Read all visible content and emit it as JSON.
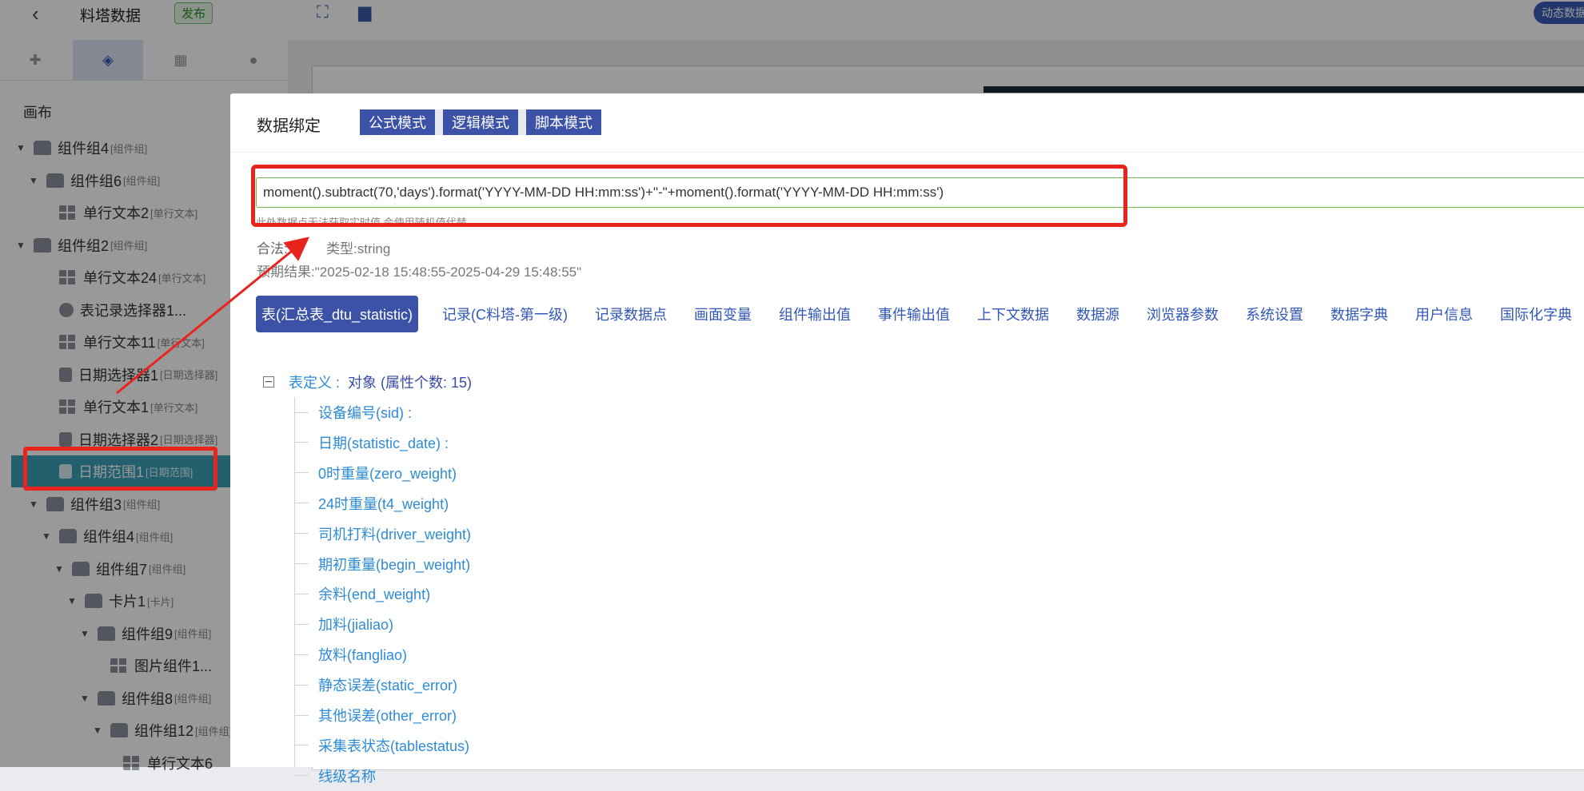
{
  "topbar": {
    "title": "料塔数据",
    "publish_label": "发布",
    "dynamic_label": "动态数据"
  },
  "left_panel": {
    "canvas_label": "画布",
    "tree": [
      {
        "level": 0,
        "arrow": "down",
        "icon": "group",
        "label": "组件组4",
        "tag": "[组件组]"
      },
      {
        "level": 1,
        "arrow": "down",
        "icon": "group",
        "label": "组件组6",
        "tag": "[组件组]"
      },
      {
        "level": 2,
        "arrow": "",
        "icon": "text",
        "label": "单行文本2",
        "tag": "[单行文本]"
      },
      {
        "level": 0,
        "arrow": "down",
        "icon": "group",
        "label": "组件组2",
        "tag": "[组件组]"
      },
      {
        "level": 2,
        "arrow": "",
        "icon": "text",
        "label": "单行文本24",
        "tag": "[单行文本]"
      },
      {
        "level": 2,
        "arrow": "",
        "icon": "pie",
        "label": "表记录选择器1...",
        "tag": ""
      },
      {
        "level": 2,
        "arrow": "",
        "icon": "text",
        "label": "单行文本11",
        "tag": "[单行文本]"
      },
      {
        "level": 2,
        "arrow": "",
        "icon": "calendar",
        "label": "日期选择器1",
        "tag": "[日期选择器]"
      },
      {
        "level": 2,
        "arrow": "",
        "icon": "text",
        "label": "单行文本1",
        "tag": "[单行文本]"
      },
      {
        "level": 2,
        "arrow": "",
        "icon": "calendar",
        "label": "日期选择器2",
        "tag": "[日期选择器]"
      },
      {
        "level": 2,
        "arrow": "",
        "icon": "calendar",
        "label": "日期范围1",
        "tag": "[日期范围]",
        "selected": true
      },
      {
        "level": 1,
        "arrow": "down",
        "icon": "group",
        "label": "组件组3",
        "tag": "[组件组]"
      },
      {
        "level": 2,
        "arrow": "down",
        "icon": "group",
        "label": "组件组4",
        "tag": "[组件组]"
      },
      {
        "level": 3,
        "arrow": "down",
        "icon": "group",
        "label": "组件组7",
        "tag": "[组件组]"
      },
      {
        "level": 4,
        "arrow": "down",
        "icon": "group",
        "label": "卡片1",
        "tag": "[卡片]"
      },
      {
        "level": 5,
        "arrow": "down",
        "icon": "group",
        "label": "组件组9",
        "tag": "[组件组]"
      },
      {
        "level": 6,
        "arrow": "",
        "icon": "text",
        "label": "图片组件1...",
        "tag": ""
      },
      {
        "level": 5,
        "arrow": "down",
        "icon": "group",
        "label": "组件组8",
        "tag": "[组件组]"
      },
      {
        "level": 6,
        "arrow": "down",
        "icon": "group",
        "label": "组件组12",
        "tag": "[组件组]"
      },
      {
        "level": 7,
        "arrow": "",
        "icon": "text",
        "label": "单行文本6",
        "tag": ""
      }
    ]
  },
  "dialog": {
    "title": "数据绑定",
    "modes": [
      "公式模式",
      "逻辑模式",
      "脚本模式"
    ],
    "expression": "moment().subtract(70,'days').format('YYYY-MM-DD HH:mm:ss')+\"-\"+moment().format('YYYY-MM-DD HH:mm:ss')",
    "hint": "此处数据点无法获取实时值,会使用随机值代替",
    "valid": "合法:是",
    "type": "类型:string",
    "preview": "预期结果:\"2025-02-18 15:48:55-2025-04-29 15:48:55\"",
    "source_tabs": [
      "表(汇总表_dtu_statistic)",
      "记录(C料塔-第一级)",
      "记录数据点",
      "画面变量",
      "组件输出值",
      "事件输出值",
      "上下文数据",
      "数据源",
      "浏览器参数",
      "系统设置",
      "数据字典",
      "用户信息",
      "国际化字典"
    ],
    "table_def_key": "表定义 :",
    "table_def_value": "对象 (属性个数: 15)",
    "fields": [
      "设备编号(sid) :",
      "日期(statistic_date) :",
      "0时重量(zero_weight)",
      "24时重量(t4_weight)",
      "司机打料(driver_weight)",
      "期初重量(begin_weight)",
      "余料(end_weight)",
      "加料(jialiao)",
      "放料(fangliao)",
      "静态误差(static_error)",
      "其他误差(other_error)",
      "采集表状态(tablestatus)",
      "线级名称"
    ]
  },
  "colors": {
    "accent": "#3b52a6",
    "link": "#2e8bd6",
    "highlight_box": "#e8241f",
    "selected_row": "#3aa0b8"
  }
}
